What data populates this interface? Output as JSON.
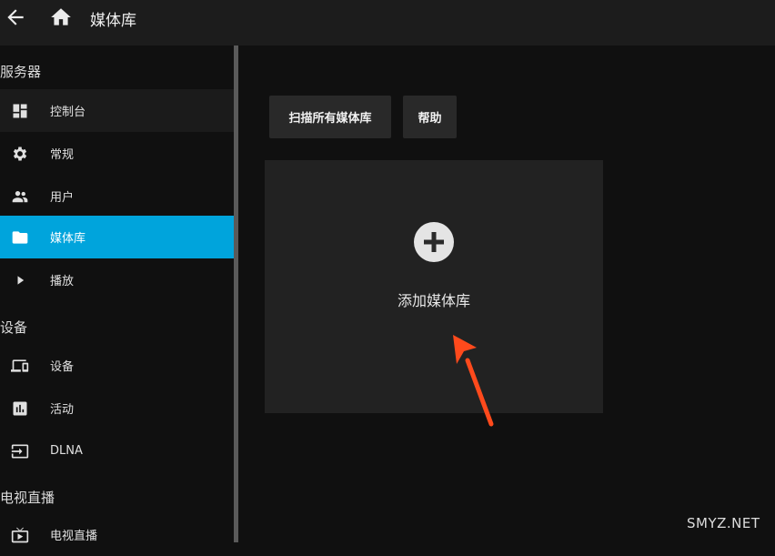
{
  "header": {
    "title": "媒体库",
    "back_icon": "arrow-left-icon",
    "home_icon": "home-icon"
  },
  "sidebar": {
    "sections": [
      {
        "label": "服务器",
        "items": [
          {
            "label": "控制台",
            "icon": "dashboard-icon"
          },
          {
            "label": "常规",
            "icon": "gear-icon"
          },
          {
            "label": "用户",
            "icon": "people-icon"
          },
          {
            "label": "媒体库",
            "icon": "folder-icon"
          },
          {
            "label": "播放",
            "icon": "play-icon"
          }
        ]
      },
      {
        "label": "设备",
        "items": [
          {
            "label": "设备",
            "icon": "devices-icon"
          },
          {
            "label": "活动",
            "icon": "bar-chart-icon"
          },
          {
            "label": "DLNA",
            "icon": "input-icon"
          }
        ]
      },
      {
        "label": "电视直播",
        "items": [
          {
            "label": "电视直播",
            "icon": "live-tv-icon"
          }
        ]
      }
    ],
    "active_item": "媒体库"
  },
  "toolbar": {
    "scan_label": "扫描所有媒体库",
    "help_label": "帮助"
  },
  "main": {
    "add_library_label": "添加媒体库",
    "add_icon": "plus-circle-icon"
  },
  "colors": {
    "accent": "#00a4dc",
    "annotation_arrow": "#ff4a1c"
  },
  "watermark": "SMYZ.NET"
}
